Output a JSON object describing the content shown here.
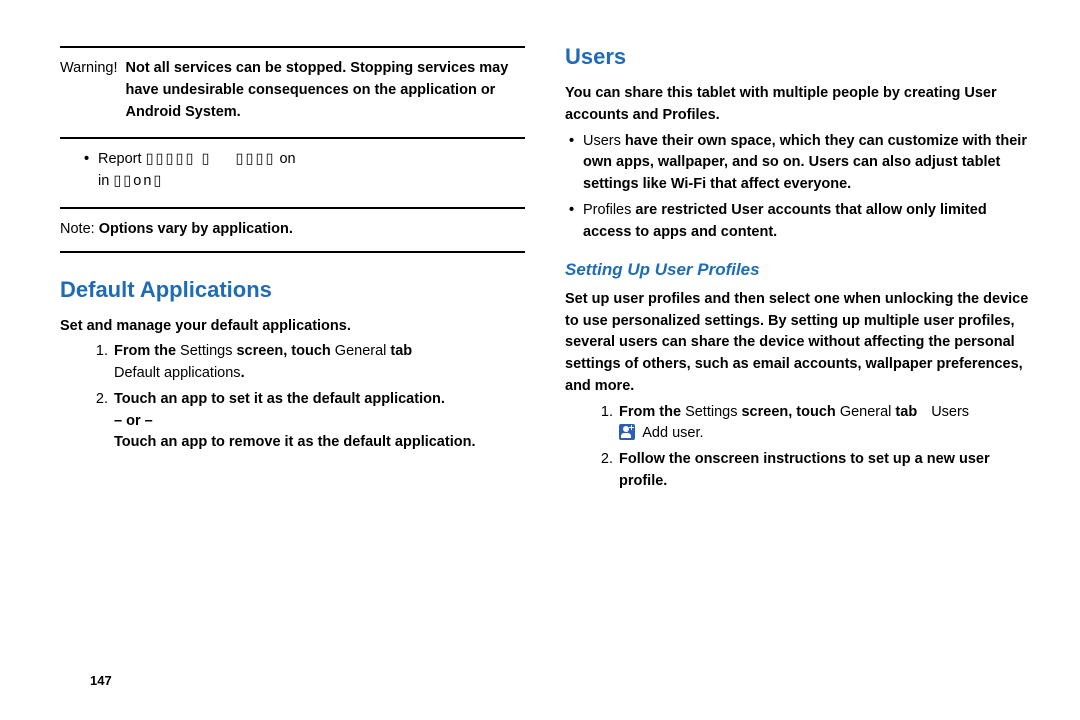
{
  "left": {
    "warning_label": "Warning!",
    "warning_text": "Not all services can be stopped. Stopping services may have undesirable consequences on the application or Android System.",
    "report_bullet1": "Report",
    "report_bullet2": "on",
    "report_bullet3": "in",
    "note_label": "Note:",
    "note_text": "Options vary by application.",
    "h1": "Default Applications",
    "intro": "Set and manage your default applications.",
    "step1_a": "From the",
    "step1_b": " Settings ",
    "step1_c": "screen, touch ",
    "step1_d": "General",
    "step1_e": " tab",
    "step1_f": "Default applications",
    "step1_g": ".",
    "step2_a": "Touch an app to set it as the default application.",
    "or": "– or –",
    "step2_b": "Touch an app to remove it as the default application."
  },
  "right": {
    "h1": "Users",
    "intro": "You can share this tablet with multiple people by creating User accounts and Profiles.",
    "bullet1_lead": "Users",
    "bullet1_rest": " have their own space, which they can customize with their own apps, wallpaper, and so on. Users can also adjust tablet settings like Wi-Fi that affect everyone.",
    "bullet2_lead": "Profiles",
    "bullet2_rest": " are restricted User accounts that allow only limited access to apps and content.",
    "h2": "Setting Up User Profiles",
    "profiles_intro": "Set up user profiles and then select one when unlocking the device to use personalized settings. By setting up multiple user profiles, several users can share the device without affecting the personal settings of others, such as email accounts, wallpaper preferences, and more.",
    "step1_a": "From the ",
    "step1_b": "Settings",
    "step1_c": " screen, touch ",
    "step1_d": "General",
    "step1_e": " tab",
    "step1_users": "Users",
    "step1_add": "Add user",
    "step1_dot": ".",
    "step2": "Follow the onscreen instructions to set up a new user profile."
  },
  "page_number": "147"
}
